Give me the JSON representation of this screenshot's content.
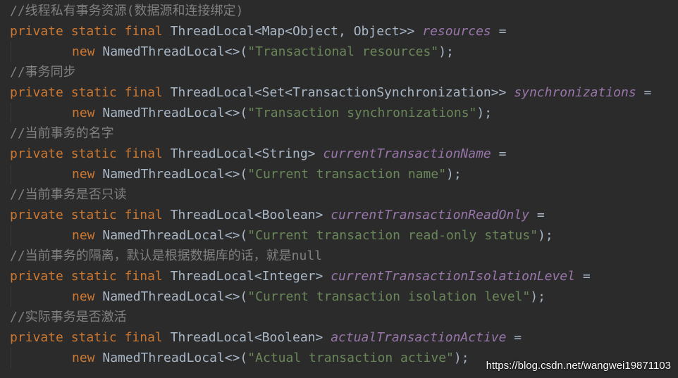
{
  "colors": {
    "background": "#2b2b2b",
    "comment": "#808080",
    "keyword": "#cc7832",
    "type": "#a9b7c6",
    "field": "#9876aa",
    "string": "#6a8759"
  },
  "keywords": {
    "private": "private",
    "static": "static",
    "final": "final",
    "new": "new"
  },
  "code": [
    {
      "comment": "//线程私有事务资源(数据源和连接绑定)",
      "type": "ThreadLocal<Map<Object, Object>>",
      "field": "resources",
      "ctor": "NamedThreadLocal<>(",
      "label": "\"Transactional resources\"",
      "end": ");"
    },
    {
      "comment": "//事务同步",
      "type": "ThreadLocal<Set<TransactionSynchronization>>",
      "field": "synchronizations",
      "ctor": "NamedThreadLocal<>(",
      "label": "\"Transaction synchronizations\"",
      "end": ");"
    },
    {
      "comment": "//当前事务的名字",
      "type": "ThreadLocal<String>",
      "field": "currentTransactionName",
      "ctor": "NamedThreadLocal<>(",
      "label": "\"Current transaction name\"",
      "end": ");"
    },
    {
      "comment": "//当前事务是否只读",
      "type": "ThreadLocal<Boolean>",
      "field": "currentTransactionReadOnly",
      "ctor": "NamedThreadLocal<>(",
      "label": "\"Current transaction read-only status\"",
      "end": ");"
    },
    {
      "comment": "//当前事务的隔离，默认是根据数据库的话，就是null",
      "type": "ThreadLocal<Integer>",
      "field": "currentTransactionIsolationLevel",
      "ctor": "NamedThreadLocal<>(",
      "label": "\"Current transaction isolation level\"",
      "end": ");"
    },
    {
      "comment": "//实际事务是否激活",
      "type": "ThreadLocal<Boolean>",
      "field": "actualTransactionActive",
      "ctor": "NamedThreadLocal<>(",
      "label": "\"Actual transaction active\"",
      "end": ");"
    }
  ],
  "assign": "=",
  "watermark": "https://blog.csdn.net/wangwei19871103"
}
